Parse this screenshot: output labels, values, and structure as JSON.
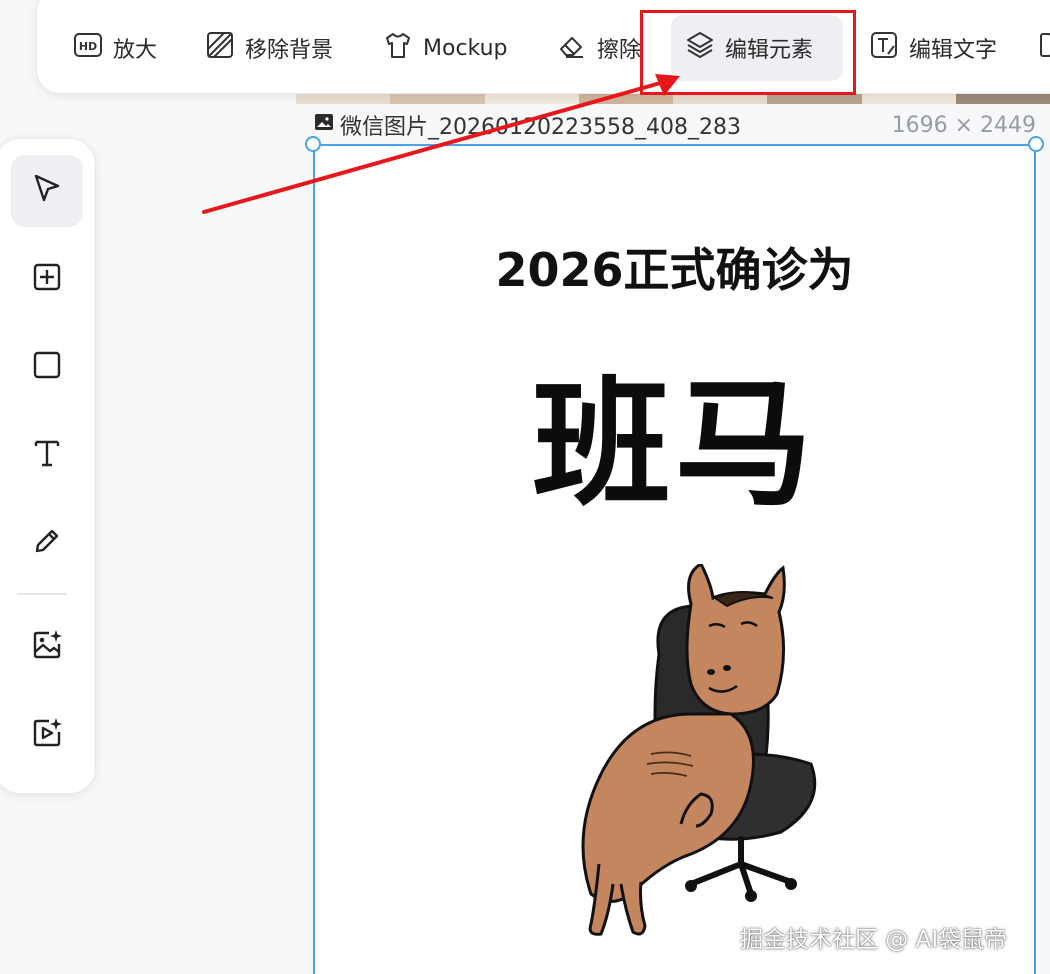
{
  "toolbar": {
    "items": [
      {
        "label": "放大",
        "icon": "hd-icon"
      },
      {
        "label": "移除背景",
        "icon": "remove-background-icon"
      },
      {
        "label": "Mockup",
        "icon": "tshirt-icon"
      },
      {
        "label": "擦除",
        "icon": "eraser-icon"
      },
      {
        "label": "编辑元素",
        "icon": "layers-icon",
        "active": true
      },
      {
        "label": "编辑文字",
        "icon": "edit-text-icon"
      }
    ]
  },
  "rail": {
    "tools": [
      {
        "icon": "select-pointer-icon",
        "active": true
      },
      {
        "icon": "add-square-icon"
      },
      {
        "icon": "rectangle-icon"
      },
      {
        "icon": "text-tool-icon"
      },
      {
        "icon": "pencil-icon"
      },
      {
        "icon": "ai-image-icon"
      },
      {
        "icon": "ai-video-icon"
      }
    ]
  },
  "canvas": {
    "image_name": "微信图片_20260120223558_408_283",
    "image_dims": "1696 × 2449",
    "poster": {
      "headline": "2026正式确诊为",
      "big_text": "班马"
    }
  },
  "watermark": "掘金技术社区 @ AI袋鼠帝",
  "colors": {
    "annotation": "#e8171b",
    "selection": "#4aa3e8",
    "horse": "#c4865f",
    "chair": "#2a2a2a"
  }
}
